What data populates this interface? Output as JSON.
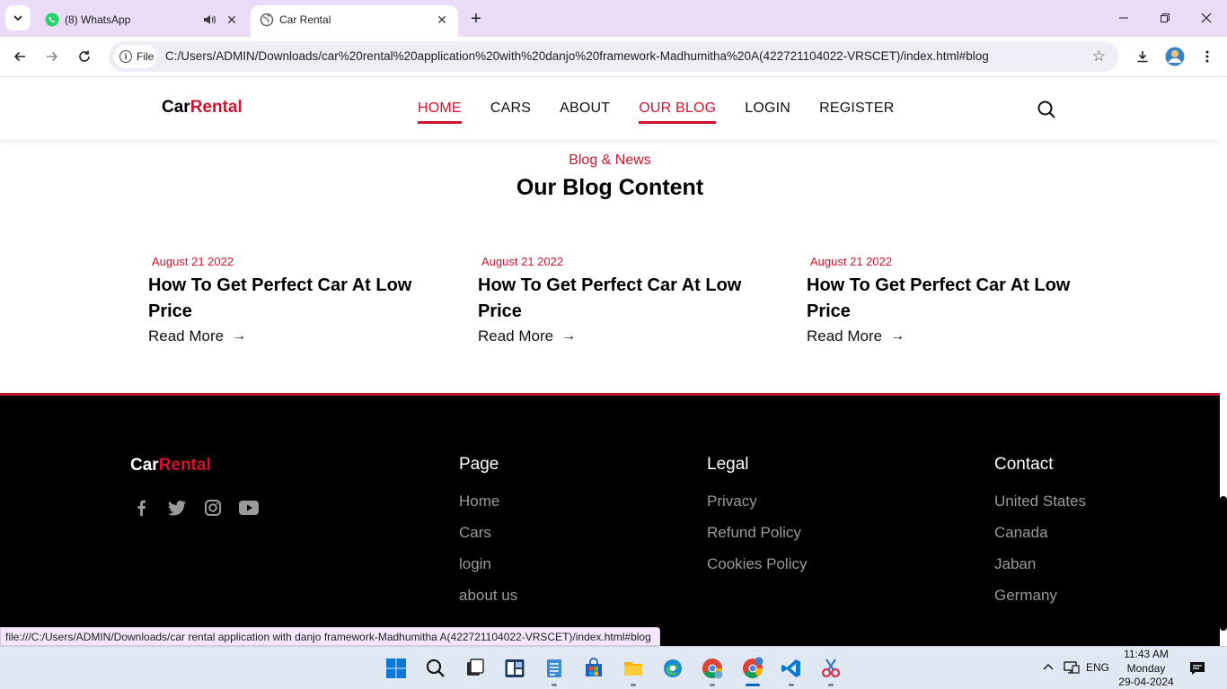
{
  "browser": {
    "tabs": [
      {
        "title": "(8) WhatsApp",
        "active": false,
        "audio": true
      },
      {
        "title": "Car Rental",
        "active": true,
        "audio": false
      }
    ],
    "chip_label": "File",
    "url": "C:/Users/ADMIN/Downloads/car%20rental%20application%20with%20danjo%20framework-Madhumitha%20A(422721104022-VRSCET)/index.html#blog",
    "status_url": "file:///C:/Users/ADMIN/Downloads/car rental application with danjo framework-Madhumitha A(422721104022-VRSCET)/index.html#blog"
  },
  "site": {
    "brand_part1": "Car",
    "brand_part2": "Rental",
    "nav": [
      {
        "label": "HOME",
        "active": true
      },
      {
        "label": "CARS",
        "active": false
      },
      {
        "label": "ABOUT",
        "active": false
      },
      {
        "label": "OUR BLOG",
        "active": true
      },
      {
        "label": "LOGIN",
        "active": false
      },
      {
        "label": "REGISTER",
        "active": false
      }
    ],
    "accent_color": "#d0122f"
  },
  "blog": {
    "subtitle": "Blog & News",
    "heading": "Our Blog Content",
    "posts": [
      {
        "date": "August 21 2022",
        "title": "How To Get Perfect Car At Low Price",
        "link": "Read More"
      },
      {
        "date": "August 21 2022",
        "title": "How To Get Perfect Car At Low Price",
        "link": "Read More"
      },
      {
        "date": "August 21 2022",
        "title": "How To Get Perfect Car At Low Price",
        "link": "Read More"
      }
    ]
  },
  "footer": {
    "social_icons": [
      "facebook-icon",
      "twitter-icon",
      "instagram-icon",
      "youtube-icon"
    ],
    "page": {
      "title": "Page",
      "links": [
        "Home",
        "Cars",
        "login",
        "about us"
      ]
    },
    "legal": {
      "title": "Legal",
      "links": [
        "Privacy",
        "Refund Policy",
        "Cookies Policy"
      ]
    },
    "contact": {
      "title": "Contact",
      "links": [
        "United States",
        "Canada",
        "Jaban",
        "Germany"
      ]
    }
  },
  "taskbar": {
    "language": "ENG",
    "time": "11:43 AM",
    "day": "Monday",
    "date": "29-04-2024"
  }
}
